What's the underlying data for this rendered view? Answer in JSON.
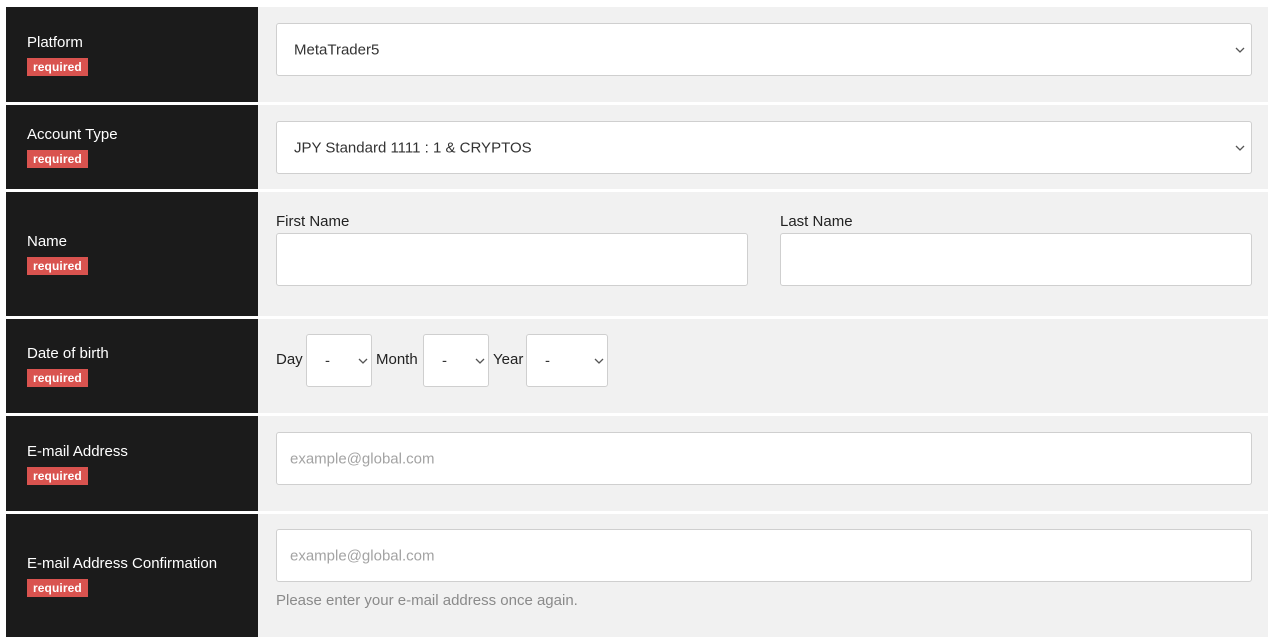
{
  "required_badge": "required",
  "colors": {
    "label_bg": "#1b1b1b",
    "field_bg": "#f1f1f1",
    "badge_bg": "#d9534f"
  },
  "rows": {
    "platform": {
      "label": "Platform",
      "selected": "MetaTrader5"
    },
    "account_type": {
      "label": "Account Type",
      "selected": "JPY Standard 1111 : 1 & CRYPTOS"
    },
    "name": {
      "label": "Name",
      "first_name_label": "First Name",
      "first_name_value": "",
      "last_name_label": "Last Name",
      "last_name_value": ""
    },
    "date_of_birth": {
      "label": "Date of birth",
      "day_label": "Day",
      "day_value": "-",
      "month_label": "Month",
      "month_value": "-",
      "year_label": "Year",
      "year_value": "-"
    },
    "email": {
      "label": "E-mail Address",
      "placeholder": "example@global.com"
    },
    "email_confirm": {
      "label": "E-mail Address Confirmation",
      "placeholder": "example@global.com",
      "hint": "Please enter your e-mail address once again."
    }
  },
  "icons": {
    "dropdown": "chevron-down-icon"
  }
}
